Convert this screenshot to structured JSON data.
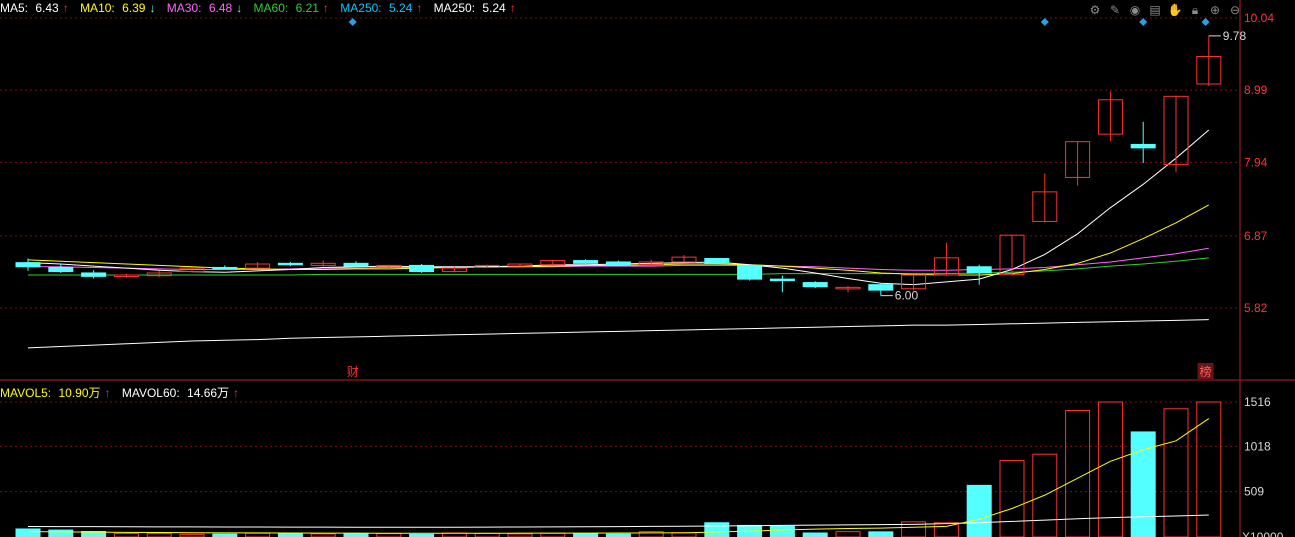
{
  "legend_top": [
    {
      "label": "MA5:",
      "value": "6.43",
      "arrow": "↑",
      "color": "#ffffff"
    },
    {
      "label": "MA10:",
      "value": "6.39",
      "arrow": "↓",
      "color": "#ffff00"
    },
    {
      "label": "MA30:",
      "value": "6.48",
      "arrow": "↓",
      "color": "#ff66ff"
    },
    {
      "label": "MA60:",
      "value": "6.21",
      "arrow": "↑",
      "color": "#33cc33"
    },
    {
      "label": "MA250:",
      "value": "5.24",
      "arrow": "↑",
      "color": "#00c8ff"
    },
    {
      "label": "MA250:",
      "value": "5.24",
      "arrow": "↑",
      "color": "#ffffff"
    }
  ],
  "legend_vol": [
    {
      "label": "MAVOL5:",
      "value": "10.90万",
      "arrow": "↑",
      "color": "#ffff00"
    },
    {
      "label": "MAVOL60:",
      "value": "14.66万",
      "arrow": "↑",
      "color": "#ffffff"
    }
  ],
  "toolbar_icons": [
    "settings-icon",
    "edit-icon",
    "eye-icon",
    "clipboard-icon",
    "hand-icon",
    "lock-icon",
    "zoom-in-icon",
    "zoom-out-icon"
  ],
  "markers": {
    "cai": "财",
    "bang": "榜",
    "high_label": "9.78",
    "low_label": "6.00"
  },
  "colors": {
    "up": "#ff3232",
    "down": "#54ffff",
    "grid": "#7a1010",
    "axis_text": "#ff3232",
    "vol_axis_text": "#d8d8d8"
  },
  "chart_data": [
    {
      "type": "candlestick",
      "y_ticks": [
        "10.04",
        "8.99",
        "7.94",
        "6.87",
        "5.82"
      ],
      "ylim": [
        5.24,
        10.04
      ],
      "candles": [
        {
          "o": 6.48,
          "h": 6.54,
          "l": 6.36,
          "c": 6.42
        },
        {
          "o": 6.41,
          "h": 6.46,
          "l": 6.33,
          "c": 6.35
        },
        {
          "o": 6.33,
          "h": 6.37,
          "l": 6.25,
          "c": 6.28
        },
        {
          "o": 6.28,
          "h": 6.32,
          "l": 6.26,
          "c": 6.3
        },
        {
          "o": 6.29,
          "h": 6.36,
          "l": 6.27,
          "c": 6.33
        },
        {
          "o": 6.35,
          "h": 6.41,
          "l": 6.34,
          "c": 6.4
        },
        {
          "o": 6.41,
          "h": 6.44,
          "l": 6.39,
          "c": 6.4
        },
        {
          "o": 6.4,
          "h": 6.49,
          "l": 6.39,
          "c": 6.46
        },
        {
          "o": 6.47,
          "h": 6.49,
          "l": 6.43,
          "c": 6.45
        },
        {
          "o": 6.44,
          "h": 6.51,
          "l": 6.42,
          "c": 6.47
        },
        {
          "o": 6.47,
          "h": 6.5,
          "l": 6.41,
          "c": 6.43
        },
        {
          "o": 6.43,
          "h": 6.45,
          "l": 6.41,
          "c": 6.44
        },
        {
          "o": 6.44,
          "h": 6.46,
          "l": 6.33,
          "c": 6.35
        },
        {
          "o": 6.35,
          "h": 6.42,
          "l": 6.34,
          "c": 6.4
        },
        {
          "o": 6.41,
          "h": 6.45,
          "l": 6.4,
          "c": 6.44
        },
        {
          "o": 6.43,
          "h": 6.47,
          "l": 6.42,
          "c": 6.46
        },
        {
          "o": 6.45,
          "h": 6.52,
          "l": 6.44,
          "c": 6.51
        },
        {
          "o": 6.51,
          "h": 6.53,
          "l": 6.46,
          "c": 6.47
        },
        {
          "o": 6.49,
          "h": 6.51,
          "l": 6.44,
          "c": 6.45
        },
        {
          "o": 6.45,
          "h": 6.52,
          "l": 6.43,
          "c": 6.49
        },
        {
          "o": 6.49,
          "h": 6.59,
          "l": 6.49,
          "c": 6.56
        },
        {
          "o": 6.54,
          "h": 6.54,
          "l": 6.45,
          "c": 6.47
        },
        {
          "o": 6.44,
          "h": 6.45,
          "l": 6.22,
          "c": 6.24
        },
        {
          "o": 6.24,
          "h": 6.29,
          "l": 6.05,
          "c": 6.23
        },
        {
          "o": 6.19,
          "h": 6.21,
          "l": 6.11,
          "c": 6.13
        },
        {
          "o": 6.1,
          "h": 6.14,
          "l": 6.05,
          "c": 6.12
        },
        {
          "o": 6.16,
          "h": 6.17,
          "l": 6.0,
          "c": 6.08
        },
        {
          "o": 6.1,
          "h": 6.31,
          "l": 6.08,
          "c": 6.3
        },
        {
          "o": 6.3,
          "h": 6.77,
          "l": 6.29,
          "c": 6.55
        },
        {
          "o": 6.42,
          "h": 6.45,
          "l": 6.16,
          "c": 6.33
        },
        {
          "o": 6.31,
          "h": 6.88,
          "l": 6.29,
          "c": 6.88
        },
        {
          "o": 7.08,
          "h": 7.78,
          "l": 7.07,
          "c": 7.51
        },
        {
          "o": 7.72,
          "h": 8.24,
          "l": 7.6,
          "c": 8.24
        },
        {
          "o": 8.35,
          "h": 8.97,
          "l": 8.25,
          "c": 8.85
        },
        {
          "o": 8.2,
          "h": 8.53,
          "l": 7.93,
          "c": 8.15
        },
        {
          "o": 7.91,
          "h": 8.91,
          "l": 7.8,
          "c": 8.9
        },
        {
          "o": 9.08,
          "h": 9.78,
          "l": 9.05,
          "c": 9.48
        }
      ],
      "ma5": [
        6.48,
        6.46,
        6.43,
        6.4,
        6.37,
        6.35,
        6.34,
        6.36,
        6.38,
        6.41,
        6.42,
        6.43,
        6.42,
        6.42,
        6.42,
        6.43,
        6.45,
        6.45,
        6.46,
        6.47,
        6.48,
        6.49,
        6.45,
        6.4,
        6.33,
        6.25,
        6.18,
        6.16,
        6.2,
        6.24,
        6.38,
        6.6,
        6.9,
        7.28,
        7.62,
        8.0,
        8.41
      ],
      "ma10": [
        6.52,
        6.5,
        6.48,
        6.46,
        6.44,
        6.42,
        6.4,
        6.39,
        6.38,
        6.38,
        6.39,
        6.39,
        6.4,
        6.41,
        6.42,
        6.42,
        6.43,
        6.44,
        6.44,
        6.45,
        6.46,
        6.46,
        6.45,
        6.43,
        6.4,
        6.37,
        6.33,
        6.31,
        6.3,
        6.3,
        6.32,
        6.38,
        6.47,
        6.62,
        6.83,
        7.06,
        7.32
      ],
      "ma30": [
        6.42,
        6.42,
        6.41,
        6.4,
        6.39,
        6.38,
        6.38,
        6.38,
        6.39,
        6.4,
        6.4,
        6.41,
        6.41,
        6.41,
        6.42,
        6.42,
        6.42,
        6.43,
        6.43,
        6.43,
        6.44,
        6.44,
        6.44,
        6.43,
        6.42,
        6.4,
        6.38,
        6.37,
        6.37,
        6.38,
        6.39,
        6.41,
        6.45,
        6.49,
        6.55,
        6.61,
        6.69
      ],
      "ma60": [
        6.3,
        6.3,
        6.3,
        6.3,
        6.3,
        6.3,
        6.3,
        6.3,
        6.3,
        6.31,
        6.31,
        6.31,
        6.31,
        6.31,
        6.31,
        6.31,
        6.31,
        6.31,
        6.31,
        6.31,
        6.31,
        6.31,
        6.31,
        6.32,
        6.32,
        6.32,
        6.32,
        6.32,
        6.32,
        6.33,
        6.34,
        6.36,
        6.39,
        6.43,
        6.46,
        6.5,
        6.55
      ],
      "ma250": [
        5.24,
        5.26,
        5.28,
        5.3,
        5.32,
        5.34,
        5.35,
        5.36,
        5.38,
        5.39,
        5.4,
        5.41,
        5.42,
        5.43,
        5.44,
        5.45,
        5.46,
        5.47,
        5.48,
        5.49,
        5.5,
        5.51,
        5.52,
        5.53,
        5.54,
        5.55,
        5.56,
        5.57,
        5.57,
        5.58,
        5.59,
        5.6,
        5.61,
        5.62,
        5.63,
        5.64,
        5.65
      ]
    },
    {
      "type": "bar",
      "y_ticks": [
        "1516",
        "1018",
        "509",
        "X10000"
      ],
      "ylim": [
        0,
        1516
      ],
      "volumes": [
        90,
        78,
        62,
        40,
        38,
        30,
        32,
        42,
        40,
        35,
        40,
        38,
        30,
        45,
        40,
        35,
        42,
        40,
        32,
        60,
        48,
        160,
        130,
        120,
        45,
        60,
        58,
        170,
        160,
        580,
        860,
        930,
        1420,
        1516,
        1180,
        1440,
        1516
      ],
      "mavol5": [
        60,
        58,
        55,
        52,
        50,
        48,
        47,
        46,
        45,
        44,
        43,
        42,
        42,
        42,
        42,
        43,
        44,
        44,
        45,
        46,
        47,
        56,
        66,
        78,
        88,
        96,
        100,
        110,
        120,
        200,
        320,
        470,
        660,
        850,
        980,
        1080,
        1330
      ],
      "mavol60": [
        118,
        117,
        116,
        115,
        114,
        113,
        112,
        112,
        111,
        111,
        110,
        110,
        110,
        110,
        111,
        112,
        113,
        115,
        117,
        119,
        121,
        124,
        127,
        130,
        133,
        136,
        139,
        142,
        150,
        160,
        175,
        190,
        205,
        218,
        228,
        236,
        247
      ]
    }
  ]
}
